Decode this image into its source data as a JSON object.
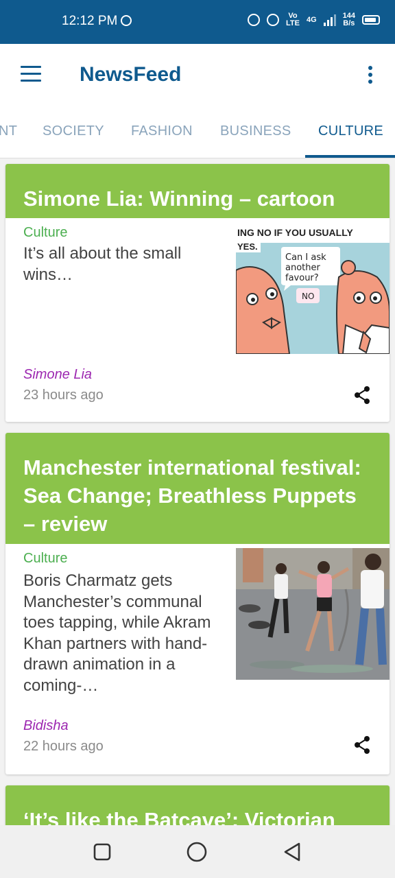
{
  "status_bar": {
    "time": "12:12 PM",
    "network_label_1": "Vo",
    "network_label_2": "LTE",
    "network_gen": "4G",
    "speed_value": "144",
    "speed_unit": "B/s"
  },
  "app_bar": {
    "title": "NewsFeed",
    "menu_icon": "hamburger-menu-icon",
    "overflow_icon": "more-vert-icon"
  },
  "tabs": [
    {
      "label": "NT",
      "active": false
    },
    {
      "label": "SOCIETY",
      "active": false
    },
    {
      "label": "FASHION",
      "active": false
    },
    {
      "label": "BUSINESS",
      "active": false
    },
    {
      "label": "CULTURE",
      "active": true
    }
  ],
  "articles": [
    {
      "headline": "Simone Lia: Winning – cartoon",
      "section": "Culture",
      "trail": "It’s all about the small wins…",
      "byline": "Simone Lia",
      "time_ago": "23 hours ago",
      "comic_caption_top_1": "ING NO IF YOU USUALLY",
      "comic_caption_top_2": "YES.",
      "comic_speech_1": "Can I ask",
      "comic_speech_2": "another",
      "comic_speech_3": "favour?",
      "comic_speech_no": "NO"
    },
    {
      "headline": "Manchester international festival: Sea Change; Breathless Puppets – review",
      "section": "Culture",
      "trail": "Boris Charmatz gets Manchester’s communal toes tapping, while Akram Khan partners with hand-drawn animation in a coming-…",
      "byline": "Bidisha",
      "time_ago": "22 hours ago"
    },
    {
      "headline": "‘It’s like the Batcave’: Victorian"
    }
  ],
  "colors": {
    "primary": "#0f5a8e",
    "card_header": "#8bc34a",
    "section": "#4caf50",
    "byline": "#9c27b0"
  }
}
